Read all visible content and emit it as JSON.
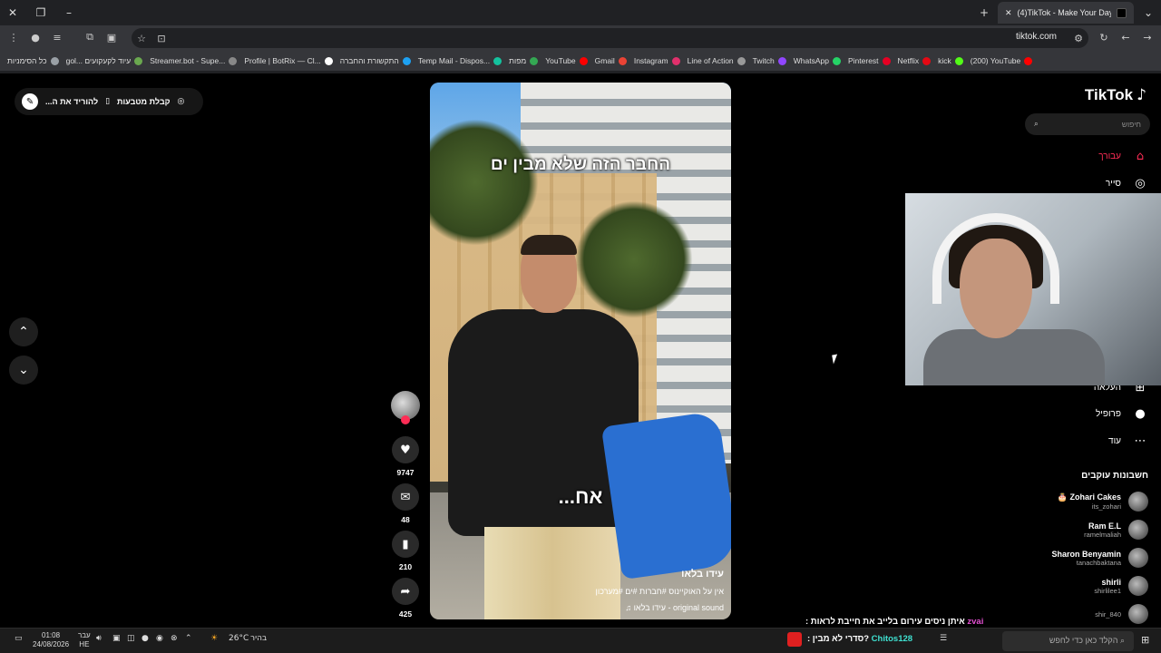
{
  "browser": {
    "tab_title": "(4)TikTok - Make Your Day",
    "url": "tiktok.com",
    "bookmarks": [
      {
        "label": "כל הסימניות",
        "color": "#9aa0a6"
      },
      {
        "label": "gol... עיוד לקעקועים",
        "color": "#6aa84f"
      },
      {
        "label": "Streamer.bot - Supe...",
        "color": "#888888"
      },
      {
        "label": "Profile | BotRix — Cl...",
        "color": "#ffffff"
      },
      {
        "label": "התקשורת והחברה",
        "color": "#1da1f2"
      },
      {
        "label": "Temp Mail - Dispos...",
        "color": "#14c29e"
      },
      {
        "label": "מפות",
        "color": "#34a853"
      },
      {
        "label": "YouTube",
        "color": "#ff0000"
      },
      {
        "label": "Gmail",
        "color": "#ea4335"
      },
      {
        "label": "Instagram",
        "color": "#e1306c"
      },
      {
        "label": "Line of Action",
        "color": "#999999"
      },
      {
        "label": "Twitch",
        "color": "#9146ff"
      },
      {
        "label": "WhatsApp",
        "color": "#25d366"
      },
      {
        "label": "Pinterest",
        "color": "#e60023"
      },
      {
        "label": "Netflix",
        "color": "#e50914"
      },
      {
        "label": "kick",
        "color": "#53fc18"
      },
      {
        "label": "(200) YouTube",
        "color": "#ff0000"
      }
    ]
  },
  "page": {
    "download_pill": {
      "label_receive": "קבלת מטבעות",
      "label_download": "להוריד את ה..."
    },
    "nav_up": "⌃",
    "nav_down": "⌄"
  },
  "video": {
    "caption_top": "החבר הזה שלא מבין ים",
    "caption_mid": "אח...",
    "author": "עידו בלאו",
    "description": "אין על האוקיינוס #חברות #ים #מערכון",
    "sound": "original sound - עידו בלאו ♫"
  },
  "actions": {
    "likes": "9747",
    "comments": "48",
    "saves": "210",
    "shares": "425"
  },
  "sidebar": {
    "logo": "TikTok",
    "search_placeholder": "חיפוש",
    "nav": [
      {
        "label": "עבורך",
        "icon": "home-icon",
        "glyph": "⌂",
        "color": "#fe2c55"
      },
      {
        "label": "סייר",
        "icon": "compass-icon",
        "glyph": "◎",
        "color": "#ffffff"
      },
      {
        "label": "העלאה",
        "icon": "upload-icon",
        "glyph": "⊞",
        "color": "#ffffff"
      },
      {
        "label": "פרופיל",
        "icon": "profile-icon",
        "glyph": "●",
        "color": "#ffffff"
      },
      {
        "label": "עוד",
        "icon": "more-icon",
        "glyph": "⋯",
        "color": "#ffffff"
      }
    ],
    "following_title": "חשבונות עוקבים",
    "following": [
      {
        "name": "Zohari Cakes 🎂",
        "handle": "its_zohari"
      },
      {
        "name": "Ram E.L",
        "handle": "ramelmaliah"
      },
      {
        "name": "Sharon Benyamin",
        "handle": "tanachbaktana"
      },
      {
        "name": "shirli",
        "handle": "shirlilee1"
      },
      {
        "name": "",
        "handle": "shir_840"
      }
    ]
  },
  "stream": {
    "chat_line1_user": "zvai",
    "chat_line1_text": "איתן ניסים עירום בלייב את חייבת לראות :",
    "chat_line2_user": "Chitos128",
    "chat_line2_text": "?סדרי לא מבין :"
  },
  "taskbar": {
    "time": "01:08",
    "date": "24/08/2026",
    "lang_top": "עבר",
    "lang_bottom": "HE",
    "weather_temp": "26°C",
    "weather_text": "בהיר",
    "search_placeholder": "הקלד כאן כדי לחפש"
  },
  "colors": {
    "accent": "#fe2c55",
    "browser_bg": "#202124",
    "toolbar_bg": "#35363a"
  }
}
